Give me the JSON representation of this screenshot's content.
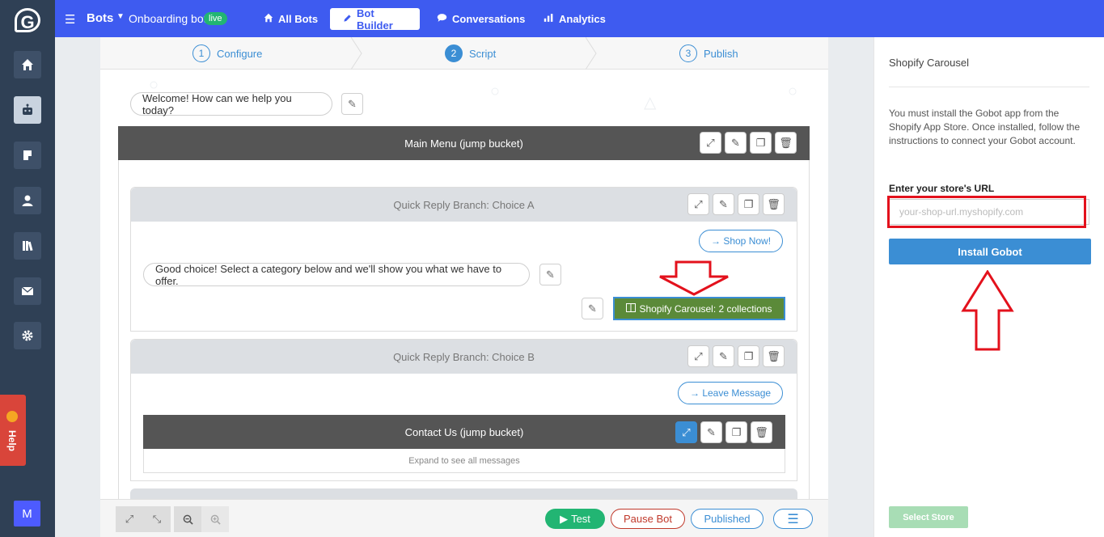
{
  "sidebar": {
    "logo": "G",
    "user_initial": "M",
    "help_label": "Help",
    "icons": [
      "home-icon",
      "robot-icon",
      "bookmark-icon",
      "user-icon",
      "library-icon",
      "mail-icon",
      "gear-icon"
    ]
  },
  "topbar": {
    "section": "Bots",
    "bot_name": "Onboarding bot",
    "status": "live",
    "tabs": [
      {
        "label": "All Bots",
        "icon": "home-icon"
      },
      {
        "label": "Bot Builder",
        "icon": "pencil-icon"
      },
      {
        "label": "Conversations",
        "icon": "chat-icon"
      },
      {
        "label": "Analytics",
        "icon": "bar-chart-icon"
      }
    ],
    "active_tab": "Bot Builder"
  },
  "steps": [
    {
      "num": "1",
      "label": "Configure"
    },
    {
      "num": "2",
      "label": "Script"
    },
    {
      "num": "3",
      "label": "Publish"
    }
  ],
  "script": {
    "welcome_message": "Welcome! How can we help you today?",
    "main_menu_title": "Main Menu (jump bucket)",
    "branch_a": {
      "title": "Quick Reply Branch: Choice A",
      "reply_label": "→ Shop Now!",
      "message": "Good choice! Select a category below and we'll show you what we have to offer.",
      "carousel_label": "Shopify Carousel: 2 collections"
    },
    "branch_b": {
      "title": "Quick Reply Branch: Choice B",
      "reply_label": "→ Leave Message",
      "contact_title": "Contact Us (jump bucket)",
      "contact_hint": "Expand to see all messages"
    }
  },
  "bottom_bar": {
    "test_label": "Test",
    "pause_label": "Pause Bot",
    "published_label": "Published"
  },
  "panel": {
    "title": "Shopify Carousel",
    "description": "You must install the Gobot app from the Shopify App Store. Once installed, follow the instructions to connect your Gobot account.",
    "url_label": "Enter your store's URL",
    "url_placeholder": "your-shop-url.myshopify.com",
    "install_label": "Install Gobot",
    "select_store_label": "Select Store"
  },
  "colors": {
    "topbar": "#3e5bf0",
    "sidebar": "#2f4055",
    "accent": "#3b8ed4",
    "live": "#22b573",
    "carousel": "#5b8a39",
    "annotation": "#e3111c"
  }
}
